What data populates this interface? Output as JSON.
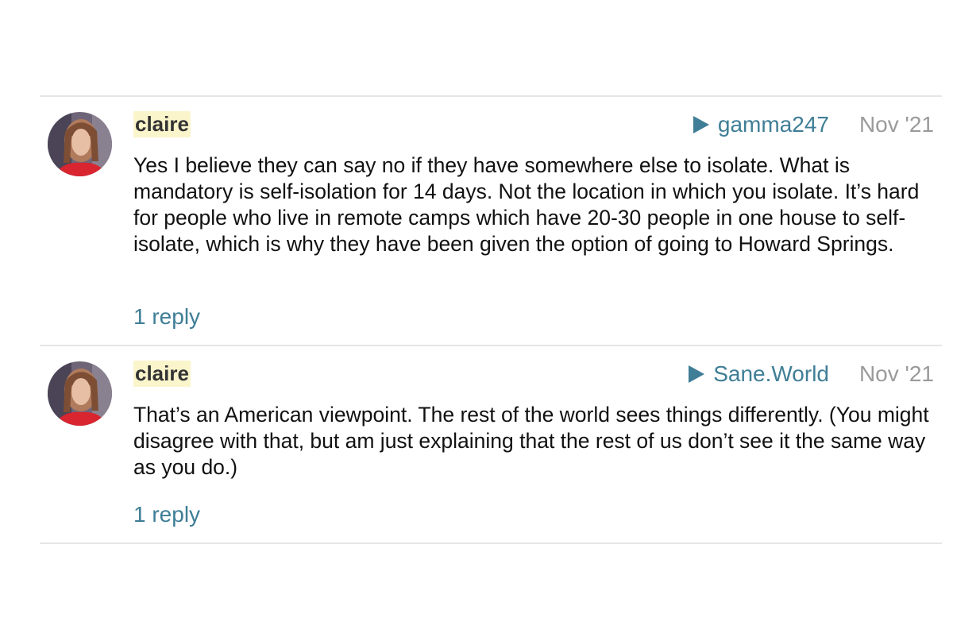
{
  "comments": [
    {
      "author": "claire",
      "in_reply_to": "gamma247",
      "date": "Nov '21",
      "text": "Yes I believe they can say no if they have somewhere else to isolate. What is mandatory is self-isolation for 14 days. Not the location in which you isolate. It’s hard for people who live in remote camps which have 20-30 people in one house to self-isolate, which is why they have been given the option of going to Howard Springs.",
      "replies_label": "1 reply"
    },
    {
      "author": "claire",
      "in_reply_to": "Sane.World",
      "date": "Nov '21",
      "text": "That’s an American viewpoint. The rest of the world sees things differently. (You might disagree with that, but am just explaining that the rest of us don’t see it the same way as you do.)",
      "replies_label": "1 reply"
    }
  ],
  "icons": {
    "reply_to": "triangle-right-icon",
    "avatar": "user-avatar"
  },
  "colors": {
    "link": "#3f7e96",
    "date": "#9a9a9a",
    "username_highlight": "#fbf5cc",
    "divider": "#e6e6e6"
  }
}
